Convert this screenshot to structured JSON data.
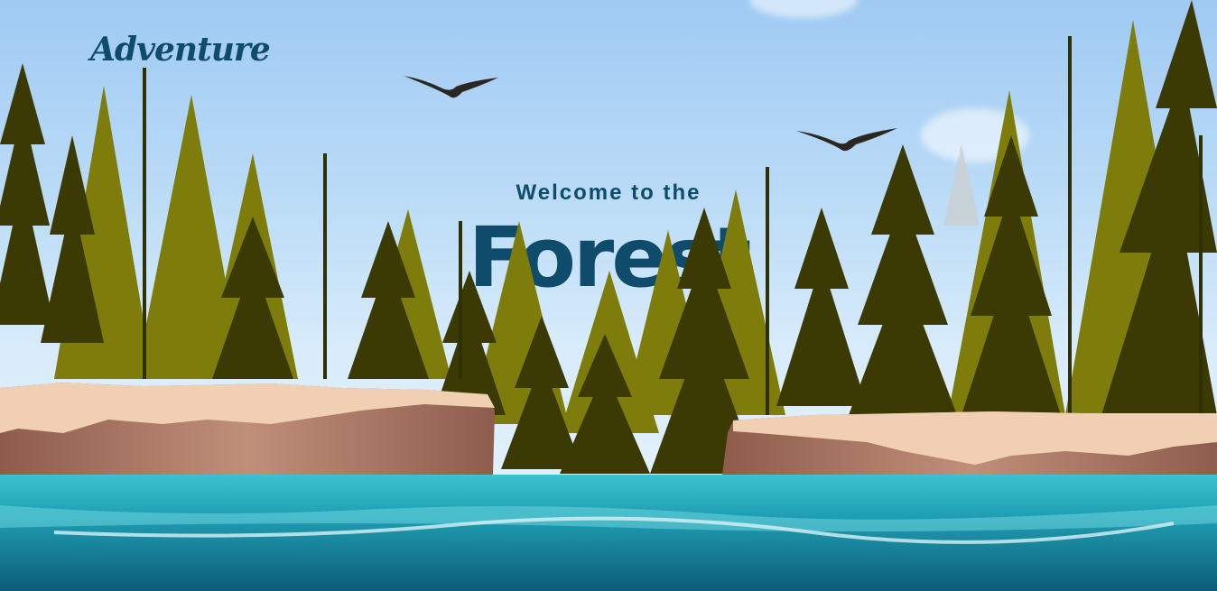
{
  "nav": {
    "logo_text": "Adventure"
  },
  "hero": {
    "welcome_text": "Welcome to the",
    "title_text": "Forest"
  },
  "colors": {
    "sky_top": "#9fcaf3",
    "text_primary": "#0f4c6b",
    "tree_light": "#7e7d0b",
    "tree_dark": "#3b3a05",
    "cliff_top": "#f1cfb2",
    "cliff_side": "#a97a66",
    "water": "#1a8aa0"
  },
  "icons": [
    "bird-icon"
  ]
}
